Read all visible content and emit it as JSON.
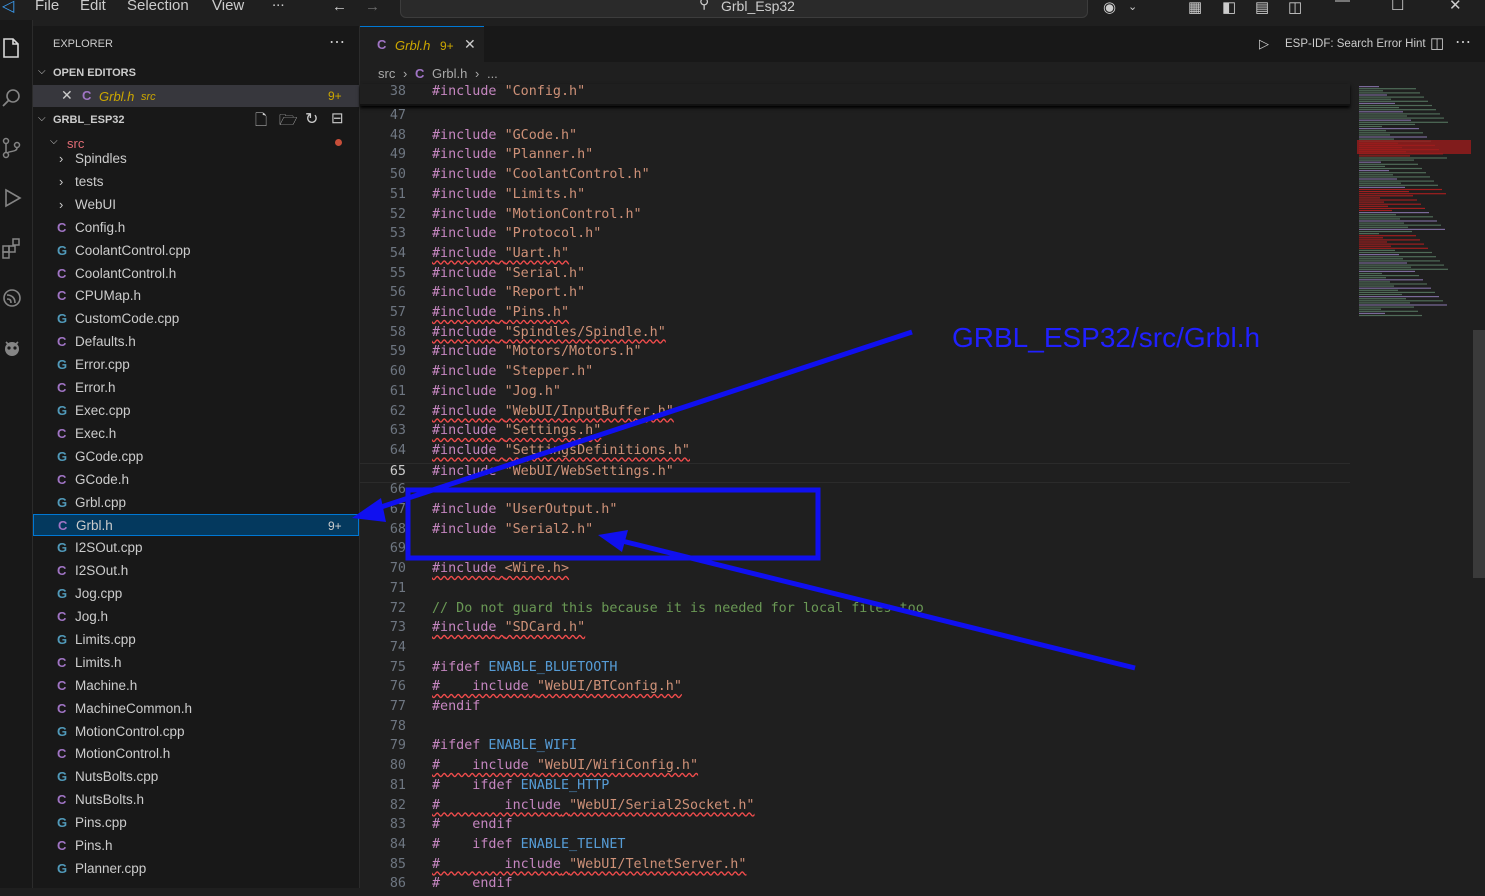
{
  "menu": {
    "file": "File",
    "edit": "Edit",
    "selection": "Selection",
    "view": "View",
    "more": "..."
  },
  "search": {
    "label": "Grbl_Esp32"
  },
  "sidebar": {
    "title": "EXPLORER",
    "open_editors": "OPEN EDITORS",
    "open_file": {
      "name": "Grbl.h",
      "dir": "src",
      "badge": "9+"
    },
    "project": "GRBL_ESP32",
    "src_folder": "src",
    "folders": [
      "Spindles",
      "tests",
      "WebUI"
    ],
    "files": [
      {
        "name": "Config.h",
        "type": "h"
      },
      {
        "name": "CoolantControl.cpp",
        "type": "cpp"
      },
      {
        "name": "CoolantControl.h",
        "type": "h"
      },
      {
        "name": "CPUMap.h",
        "type": "h"
      },
      {
        "name": "CustomCode.cpp",
        "type": "cpp"
      },
      {
        "name": "Defaults.h",
        "type": "h"
      },
      {
        "name": "Error.cpp",
        "type": "cpp"
      },
      {
        "name": "Error.h",
        "type": "h"
      },
      {
        "name": "Exec.cpp",
        "type": "cpp"
      },
      {
        "name": "Exec.h",
        "type": "h"
      },
      {
        "name": "GCode.cpp",
        "type": "cpp"
      },
      {
        "name": "GCode.h",
        "type": "h"
      },
      {
        "name": "Grbl.cpp",
        "type": "cpp"
      },
      {
        "name": "Grbl.h",
        "type": "h",
        "selected": true,
        "badge": "9+"
      },
      {
        "name": "I2SOut.cpp",
        "type": "cpp"
      },
      {
        "name": "I2SOut.h",
        "type": "h"
      },
      {
        "name": "Jog.cpp",
        "type": "cpp"
      },
      {
        "name": "Jog.h",
        "type": "h"
      },
      {
        "name": "Limits.cpp",
        "type": "cpp"
      },
      {
        "name": "Limits.h",
        "type": "h"
      },
      {
        "name": "Machine.h",
        "type": "h"
      },
      {
        "name": "MachineCommon.h",
        "type": "h"
      },
      {
        "name": "MotionControl.cpp",
        "type": "cpp"
      },
      {
        "name": "MotionControl.h",
        "type": "h"
      },
      {
        "name": "NutsBolts.cpp",
        "type": "cpp"
      },
      {
        "name": "NutsBolts.h",
        "type": "h"
      },
      {
        "name": "Pins.cpp",
        "type": "cpp"
      },
      {
        "name": "Pins.h",
        "type": "h"
      },
      {
        "name": "Planner.cpp",
        "type": "cpp"
      }
    ]
  },
  "tab": {
    "name": "Grbl.h",
    "badge": "9+"
  },
  "toolbar": {
    "esp_idf": "ESP-IDF: Search Error Hint"
  },
  "breadcrumb": {
    "folder": "src",
    "file": "Grbl.h",
    "more": "..."
  },
  "sticky_line": {
    "num": "38",
    "code": "#include \"Config.h\""
  },
  "code_lines": [
    {
      "num": "47",
      "code": ""
    },
    {
      "num": "48",
      "code": "#include \"GCode.h\""
    },
    {
      "num": "49",
      "code": "#include \"Planner.h\""
    },
    {
      "num": "50",
      "code": "#include \"CoolantControl.h\""
    },
    {
      "num": "51",
      "code": "#include \"Limits.h\""
    },
    {
      "num": "52",
      "code": "#include \"MotionControl.h\""
    },
    {
      "num": "53",
      "code": "#include \"Protocol.h\""
    },
    {
      "num": "54",
      "code": "#include \"Uart.h\""
    },
    {
      "num": "55",
      "code": "#include \"Serial.h\""
    },
    {
      "num": "56",
      "code": "#include \"Report.h\""
    },
    {
      "num": "57",
      "code": "#include \"Pins.h\""
    },
    {
      "num": "58",
      "code": "#include \"Spindles/Spindle.h\""
    },
    {
      "num": "59",
      "code": "#include \"Motors/Motors.h\""
    },
    {
      "num": "60",
      "code": "#include \"Stepper.h\""
    },
    {
      "num": "61",
      "code": "#include \"Jog.h\""
    },
    {
      "num": "62",
      "code": "#include \"WebUI/InputBuffer.h\""
    },
    {
      "num": "63",
      "code": "#include \"Settings.h\""
    },
    {
      "num": "64",
      "code": "#include \"SettingsDefinitions.h\""
    },
    {
      "num": "65",
      "code": "#include \"WebUI/WebSettings.h\""
    },
    {
      "num": "66",
      "code": ""
    },
    {
      "num": "67",
      "code": "#include \"UserOutput.h\""
    },
    {
      "num": "68",
      "code": "#include \"Serial2.h\""
    },
    {
      "num": "69",
      "code": ""
    },
    {
      "num": "70",
      "code": "#include <Wire.h>"
    },
    {
      "num": "71",
      "code": ""
    },
    {
      "num": "72",
      "code": "// Do not guard this because it is needed for local files too"
    },
    {
      "num": "73",
      "code": "#include \"SDCard.h\""
    },
    {
      "num": "74",
      "code": ""
    },
    {
      "num": "75",
      "code": "#ifdef ENABLE_BLUETOOTH"
    },
    {
      "num": "76",
      "code": "#    include \"WebUI/BTConfig.h\""
    },
    {
      "num": "77",
      "code": "#endif"
    },
    {
      "num": "78",
      "code": ""
    },
    {
      "num": "79",
      "code": "#ifdef ENABLE_WIFI"
    },
    {
      "num": "80",
      "code": "#    include \"WebUI/WifiConfig.h\""
    },
    {
      "num": "81",
      "code": "#    ifdef ENABLE_HTTP"
    },
    {
      "num": "82",
      "code": "#        include \"WebUI/Serial2Socket.h\""
    },
    {
      "num": "83",
      "code": "#    endif"
    },
    {
      "num": "84",
      "code": "#    ifdef ENABLE_TELNET"
    },
    {
      "num": "85",
      "code": "#        include \"WebUI/TelnetServer.h\""
    },
    {
      "num": "86",
      "code": "#    endif"
    }
  ],
  "annotation": {
    "text": "GRBL_ESP32/src/Grbl.h",
    "color": "#2020ff"
  }
}
